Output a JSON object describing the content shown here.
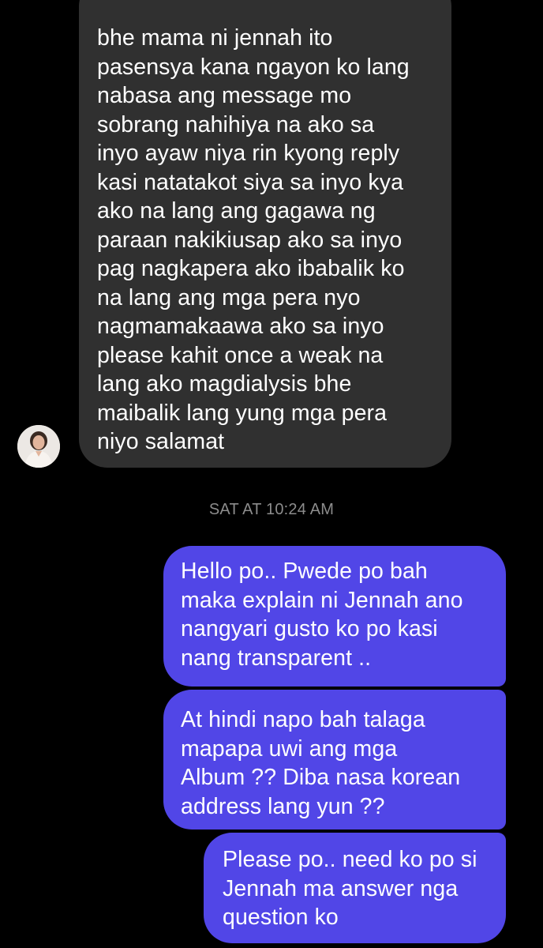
{
  "thread": {
    "received_message": "bhe mama ni jennah ito\npasensya kana  ngayon ko lang\nnabasa ang message mo\nsobrang nahihiya na ako sa\ninyo ayaw niya rin kyong reply\nkasi natatakot siya sa inyo kya\nako na lang ang gagawa ng\nparaan nakikiusap ako sa inyo\npag nagkapera ako ibabalik ko\nna lang ang mga pera nyo\nnagmamakaawa ako sa inyo\nplease kahit once a weak na\nlang ako magdialysis bhe\nmaibalik lang yung mga pera\nniyo salamat",
    "timestamp": "SAT AT 10:24 AM",
    "sent_messages": [
      "Hello po.. Pwede po bah\nmaka explain ni Jennah ano\nnangyari gusto ko po kasi\nnang transparent ..",
      "At hindi napo bah talaga\nmapapa uwi ang mga\nAlbum ?? Diba nasa korean\naddress lang yun ??",
      "Please po.. need ko po si\nJennah ma answer nga\nquestion ko"
    ]
  },
  "colors": {
    "background": "#000000",
    "received_bubble": "#303030",
    "sent_bubble": "#5146e7",
    "timestamp_text": "#8c8c8c"
  },
  "icons": {
    "sender_avatar": "profile-photo-avatar"
  }
}
